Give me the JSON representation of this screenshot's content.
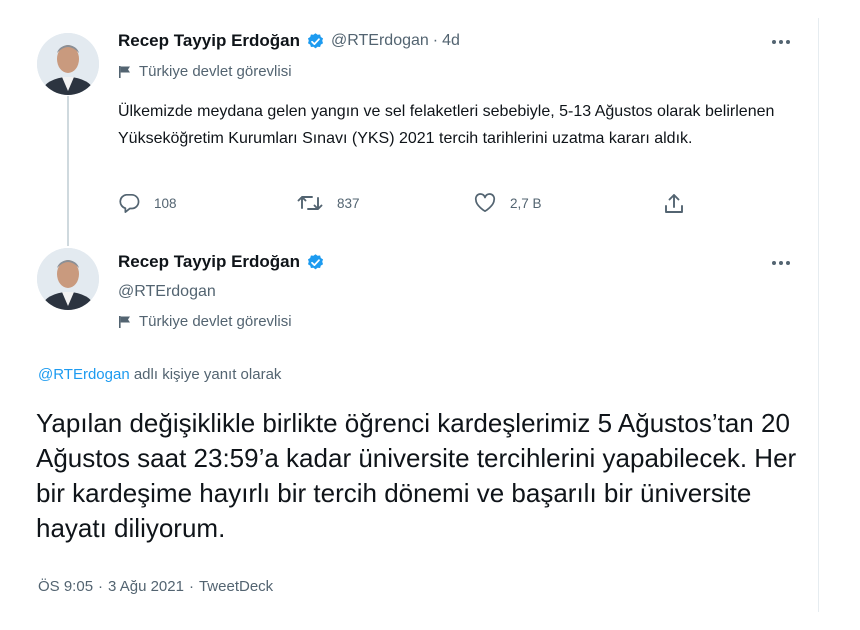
{
  "tweet1": {
    "name": "Recep Tayyip Erdoğan",
    "handle": "@RTErdogan",
    "dot": "·",
    "time": "4d",
    "label": "Türkiye devlet görevlisi",
    "text": "Ülkemizde meydana gelen yangın ve sel felaketleri sebebiyle, 5-13 Ağustos olarak belirlenen Yükseköğretim Kurumları Sınavı (YKS) 2021 tercih tarihlerini uzatma kararı aldık.",
    "actions": {
      "reply_count": "108",
      "retweet_count": "837",
      "like_count": "2,7 B"
    }
  },
  "tweet2": {
    "name": "Recep Tayyip Erdoğan",
    "handle": "@RTErdogan",
    "label": "Türkiye devlet görevlisi",
    "reply_mention": "@RTErdogan",
    "reply_suffix": " adlı kişiye yanıt olarak",
    "text": "Yapılan değişiklikle birlikte öğrenci kardeşlerimiz 5 Ağustos’tan 20 Ağustos saat 23:59’a kadar üniversite tercihlerini yapabilecek. Her bir kardeşime hayırlı bir tercih dönemi ve başarılı bir üniversite hayatı diliyorum.",
    "time": "ÖS 9:05",
    "sep": "·",
    "date": "3 Ağu 2021",
    "source": "TweetDeck"
  },
  "icons": {
    "verified": "verified-badge-icon",
    "flag": "flag-icon",
    "more": "more-icon",
    "reply": "reply-icon",
    "retweet": "retweet-icon",
    "like": "like-icon",
    "share": "share-icon"
  },
  "colors": {
    "accent": "#1d9bf0",
    "text": "#0f1419",
    "muted": "#536471"
  }
}
